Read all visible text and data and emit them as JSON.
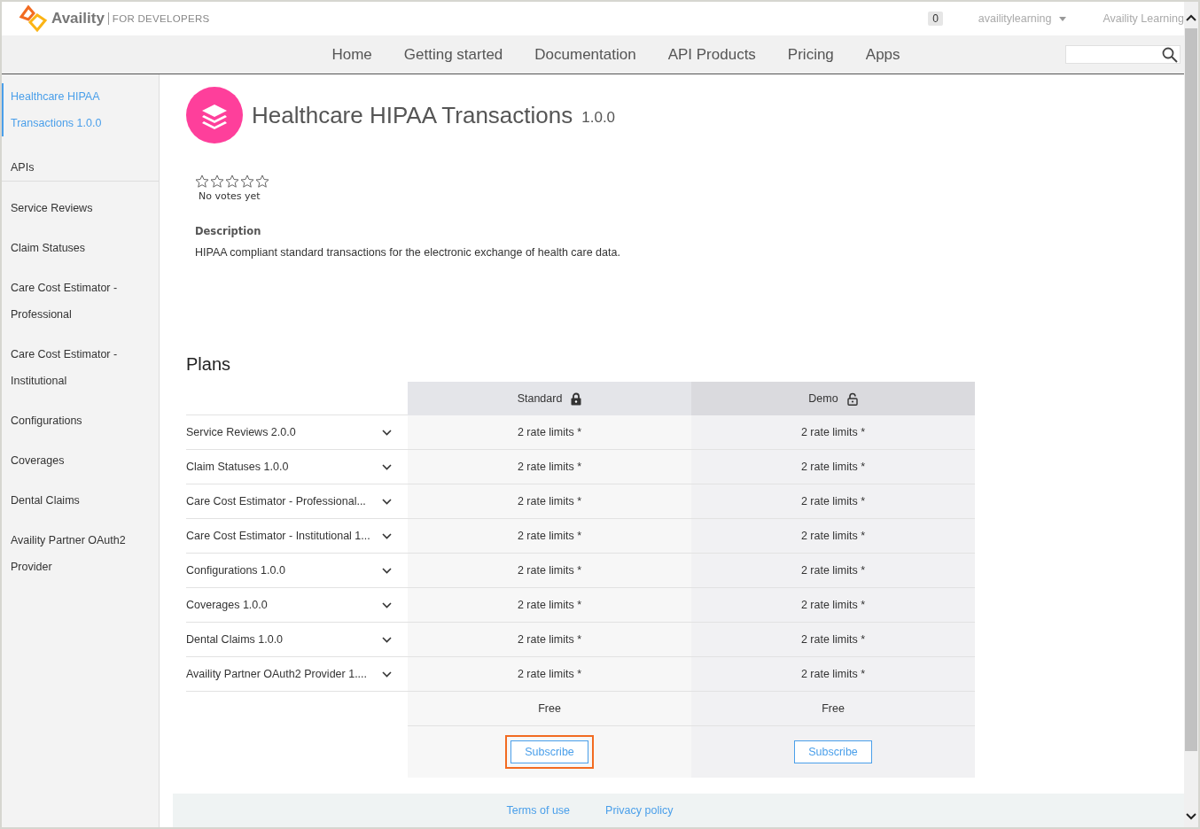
{
  "header": {
    "brand": "Availity",
    "tagline": "FOR DEVELOPERS",
    "notification_count": "0",
    "username": "availitylearning",
    "organization": "Availity Learning"
  },
  "nav": {
    "items": [
      {
        "label": "Home",
        "selected": false
      },
      {
        "label": "Getting started",
        "selected": false
      },
      {
        "label": "Documentation",
        "selected": false
      },
      {
        "label": "API Products",
        "selected": false
      },
      {
        "label": "Pricing",
        "selected": false
      },
      {
        "label": "Apps",
        "selected": false
      }
    ]
  },
  "sidebar": {
    "product": {
      "label": "Healthcare HIPAA Transactions 1.0.0",
      "selected": true
    },
    "heading": "APIs",
    "items": [
      {
        "label": "Service Reviews",
        "selected": false
      },
      {
        "label": "Claim Statuses",
        "selected": false
      },
      {
        "label": "Care Cost Estimator - Professional",
        "selected": false
      },
      {
        "label": "Care Cost Estimator - Institutional",
        "selected": false
      },
      {
        "label": "Configurations",
        "selected": false
      },
      {
        "label": "Coverages",
        "selected": false
      },
      {
        "label": "Dental Claims",
        "selected": false
      },
      {
        "label": "Availity Partner OAuth2 Provider",
        "selected": false
      }
    ]
  },
  "product": {
    "title": "Healthcare HIPAA Transactions",
    "version": "1.0.0",
    "stars": 0,
    "votes": "No votes yet",
    "description_label": "Description",
    "description": "HIPAA compliant standard transactions for the electronic exchange of health care data."
  },
  "plans": {
    "title": "Plans",
    "columns": [
      {
        "name": "Standard",
        "locked": true,
        "price": "Free",
        "button": "Subscribe",
        "highlighted": true
      },
      {
        "name": "Demo",
        "locked": false,
        "price": "Free",
        "button": "Subscribe",
        "highlighted": false
      }
    ],
    "rows": [
      {
        "api": "Service Reviews 2.0.0",
        "limits": [
          "2 rate limits *",
          "2 rate limits *"
        ]
      },
      {
        "api": "Claim Statuses 1.0.0",
        "limits": [
          "2 rate limits *",
          "2 rate limits *"
        ]
      },
      {
        "api": "Care Cost Estimator - Professional...",
        "limits": [
          "2 rate limits *",
          "2 rate limits *"
        ]
      },
      {
        "api": "Care Cost Estimator - Institutional 1...",
        "limits": [
          "2 rate limits *",
          "2 rate limits *"
        ]
      },
      {
        "api": "Configurations 1.0.0",
        "limits": [
          "2 rate limits *",
          "2 rate limits *"
        ]
      },
      {
        "api": "Coverages 1.0.0",
        "limits": [
          "2 rate limits *",
          "2 rate limits *"
        ]
      },
      {
        "api": "Dental Claims 1.0.0",
        "limits": [
          "2 rate limits *",
          "2 rate limits *"
        ]
      },
      {
        "api": "Availity Partner OAuth2 Provider 1....",
        "limits": [
          "2 rate limits *",
          "2 rate limits *"
        ]
      }
    ]
  },
  "footer": {
    "links": [
      "Terms of use",
      "Privacy policy"
    ]
  }
}
